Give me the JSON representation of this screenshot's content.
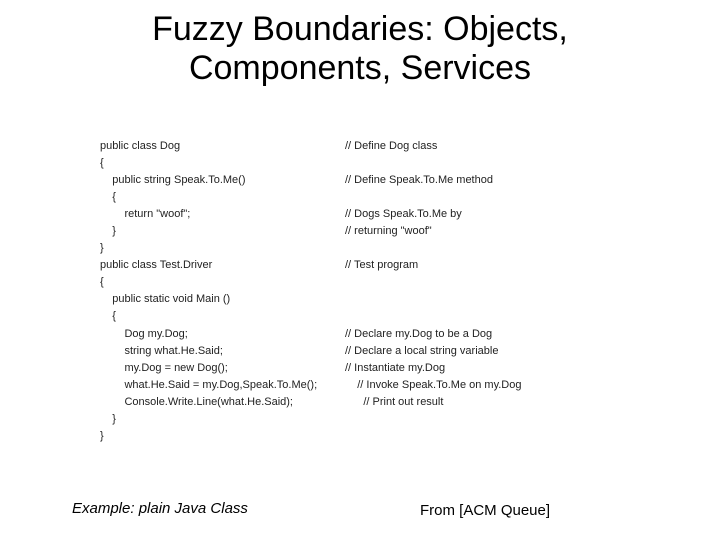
{
  "title_line1": "Fuzzy Boundaries: Objects,",
  "title_line2": "Components, Services",
  "code": [
    {
      "indent": 0,
      "text": "public class Dog",
      "comment": "// Define Dog class"
    },
    {
      "indent": 0,
      "text": "{",
      "comment": ""
    },
    {
      "indent": 1,
      "text": "public string Speak.To.Me()",
      "comment": "// Define Speak.To.Me method"
    },
    {
      "indent": 1,
      "text": "{",
      "comment": ""
    },
    {
      "indent": 2,
      "text": "return \"woof\";",
      "comment": "// Dogs Speak.To.Me by"
    },
    {
      "indent": 1,
      "text": "}",
      "comment": "// returning \"woof\""
    },
    {
      "indent": 0,
      "text": "}",
      "comment": ""
    },
    {
      "indent": 0,
      "text": "public class Test.Driver",
      "comment": "// Test program"
    },
    {
      "indent": 0,
      "text": "{",
      "comment": ""
    },
    {
      "indent": 1,
      "text": "public static void Main ()",
      "comment": ""
    },
    {
      "indent": 1,
      "text": "{",
      "comment": ""
    },
    {
      "indent": 2,
      "text": "Dog my.Dog;",
      "comment": "// Declare my.Dog to be a Dog"
    },
    {
      "indent": 2,
      "text": "string what.He.Said;",
      "comment": "// Declare a local string variable"
    },
    {
      "indent": 2,
      "text": "my.Dog = new Dog();",
      "comment": "// Instantiate my.Dog"
    },
    {
      "indent": 2,
      "text": "what.He.Said = my.Dog,Speak.To.Me();",
      "comment": "    // Invoke Speak.To.Me on my.Dog"
    },
    {
      "indent": 2,
      "text": "Console.Write.Line(what.He.Said);",
      "comment": "      // Print out result"
    },
    {
      "indent": 1,
      "text": "}",
      "comment": ""
    },
    {
      "indent": 0,
      "text": "}",
      "comment": ""
    }
  ],
  "caption_left": "Example: plain Java Class",
  "caption_right": "From [ACM Queue]"
}
